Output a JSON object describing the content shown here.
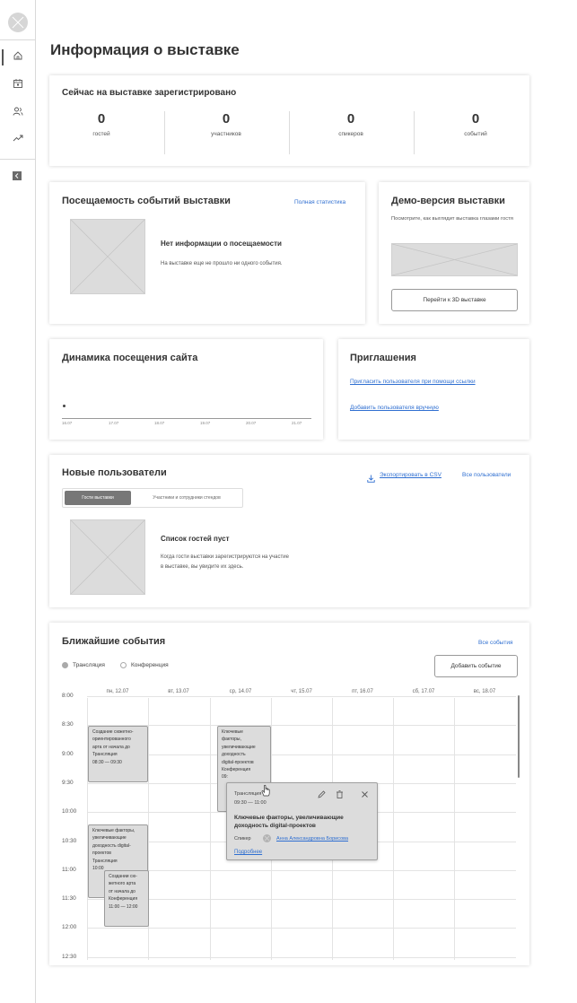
{
  "page_title": "Информация о выставке",
  "registered": {
    "title": "Сейчас на выставке зарегистрировано",
    "stats": [
      {
        "value": "0",
        "label": "гостей"
      },
      {
        "value": "0",
        "label": "участников"
      },
      {
        "value": "0",
        "label": "спикеров"
      },
      {
        "value": "0",
        "label": "событий"
      }
    ]
  },
  "attendance": {
    "title": "Посещаемость событий выставки",
    "full_stats_link": "Полная статистика",
    "empty_title": "Нет информации о посещаемости",
    "empty_text": "На выставке еще не прошло ни одного события."
  },
  "demo": {
    "title": "Демо-версия выставки",
    "text": "Посмотрите, как выглядит выставка глазами гостя",
    "button": "Перейти к 3D выставке"
  },
  "site_dynamics": {
    "title": "Динамика посещения сайта",
    "dates": [
      "16.07",
      "17.07",
      "18.07",
      "19.07",
      "20.07",
      "21.07"
    ]
  },
  "invitations": {
    "title": "Приглашения",
    "link_invite": "Пригласить пользователя при помощи ссылки",
    "link_add": "Добавить пользователя вручную"
  },
  "new_users": {
    "title": "Новые пользователи",
    "export": "Экспортировать в CSV",
    "all_users": "Все пользователи",
    "tab_guests": "Гости выставки",
    "tab_participants": "Участники и сотрудники стендов",
    "empty_title": "Список гостей пуст",
    "empty_text_1": "Когда гости  выставки зарегистрируются на участие",
    "empty_text_2": "в выставке, вы увидите их здесь."
  },
  "events": {
    "title": "Ближайшие события",
    "all_events": "Все события",
    "legend_stream": "Трансляция",
    "legend_conf": "Конференция",
    "add_button": "Добавить событие",
    "days": [
      "пн, 12.07",
      "вт, 13.07",
      "ср, 14.07",
      "чт, 15.07",
      "пт, 16.07",
      "сб, 17.07",
      "вс, 18.07"
    ],
    "times": [
      "8:00",
      "8:30",
      "9:00",
      "9:30",
      "10:00",
      "10:30",
      "11:00",
      "11:30",
      "12:00",
      "12:30"
    ],
    "event1": [
      "Создание сюжетно-",
      "ориентированного",
      "арта от начала до",
      "Трансляция",
      "08:30 — 09:30"
    ],
    "event2": [
      "Ключевые",
      "факторы,",
      "увеличивающие",
      "доходность",
      "digital-проектов",
      "Конференция",
      "09:"
    ],
    "event3": [
      "Ключевые факторы,",
      "увеличивающие",
      "доходность digital-",
      "проектов",
      "Трансляция",
      "10:00"
    ],
    "event4": [
      "Создании сю-",
      "жетного арта",
      "от начала до",
      "Конференция",
      "11:00 — 12:00"
    ],
    "popup": {
      "type": "Трансляция",
      "time": "09:30 — 11:00",
      "title_1": "Ключевые факторы, увеличивающие",
      "title_2": "доходность digital-проектов",
      "speaker_label": "Спикер",
      "speaker_name": "Анна Александровна Борисова",
      "more": "Подробнее"
    }
  },
  "colors": {
    "accent": "#2f6fd1",
    "placeholder": "#dcdcdc"
  }
}
